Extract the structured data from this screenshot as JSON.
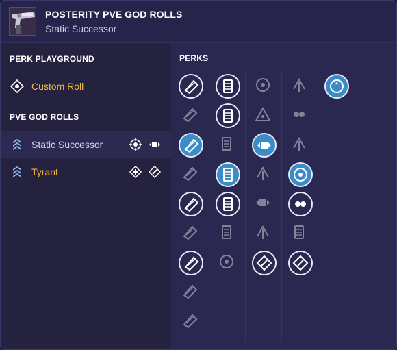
{
  "header": {
    "title": "POSTERITY PVE GOD ROLLS",
    "subtitle": "Static Successor"
  },
  "sidebar": {
    "playground_label": "PERK PLAYGROUND",
    "custom_roll_label": "Custom Roll",
    "god_rolls_label": "PVE GOD ROLLS",
    "rolls": [
      {
        "label": "Static Successor",
        "color": "#d7d5ee"
      },
      {
        "label": "Tyrant",
        "color": "#f2b844"
      }
    ]
  },
  "perks": {
    "title": "PERKS",
    "columns": [
      [
        "barrel-arrow-icon",
        "barrel-icon",
        "selected-barrel-icon",
        "barrel-dot-icon",
        "barrel-cross-icon",
        "barrel-long-icon",
        "barrel-round-icon",
        "barrel-small-icon",
        "barrel-small-icon"
      ],
      [
        "magazine-lines-icon",
        "magazine-box-icon",
        "magazine-pin-icon",
        "selected-magazine-icon",
        "magazine-stack-icon",
        "magazine-flat-icon",
        "crosshair-icon"
      ],
      [
        "target-ring-icon",
        "triangle-eye-icon",
        "selected-burst-icon",
        "wing-icon",
        "flames-icon",
        "triple-arrows-icon",
        "diamond-slash-icon"
      ],
      [
        "shield-spark-icon",
        "figure-icon",
        "swirl-icon",
        "selected-target-icon",
        "double-droplet-icon",
        "stack-icon",
        "diamond-burst-icon"
      ],
      [
        "selected-cycle-icon"
      ]
    ]
  }
}
